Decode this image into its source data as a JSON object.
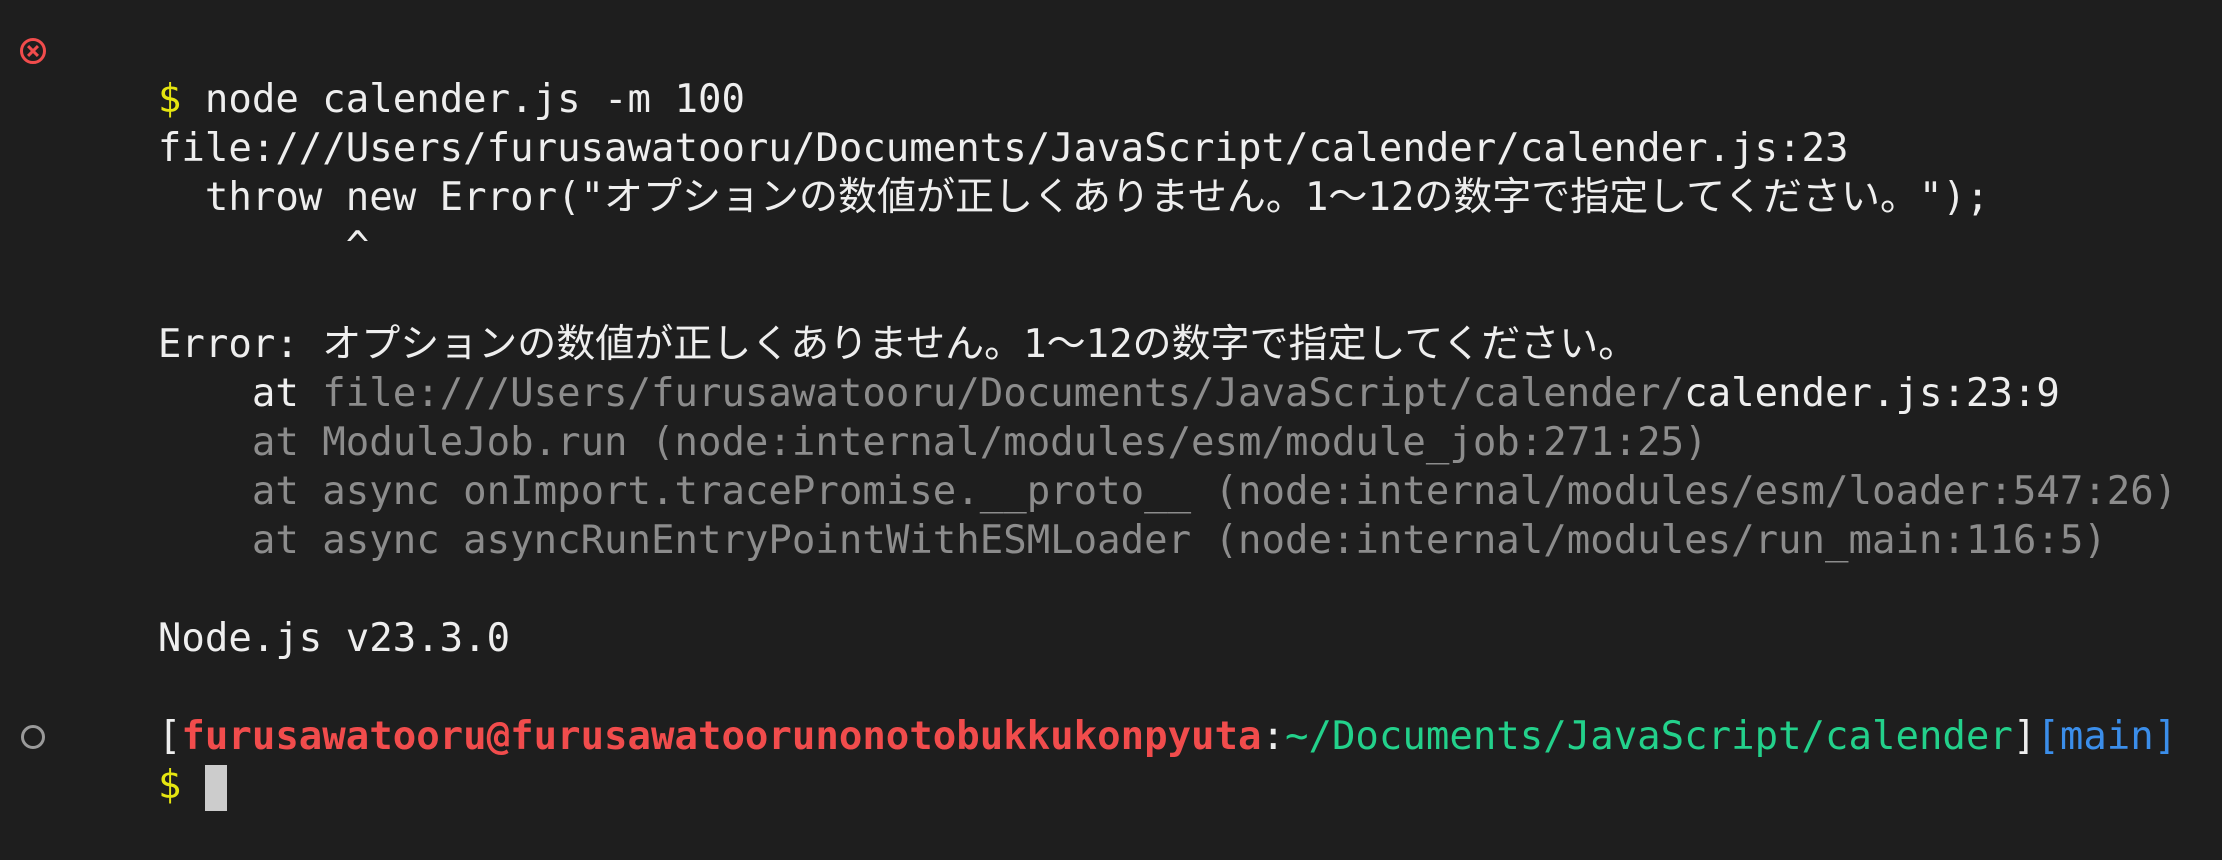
{
  "terminal": {
    "command": {
      "prompt_symbol": "$",
      "text": "node calender.js -m 100"
    },
    "output": {
      "file_ref": "file:///Users/furusawatooru/Documents/JavaScript/calender/calender.js:23",
      "code_line": "  throw new Error(\"オプションの数値が正しくありません。1〜12の数字で指定してください。\");",
      "caret": "        ^",
      "error_message": "Error: オプションの数値が正しくありません。1〜12の数字で指定してください。",
      "stack": [
        {
          "at": "    at ",
          "location_dim": "file:///Users/furusawatooru/Documents/JavaScript/calender/",
          "location_bright": "calender.js:23:9"
        },
        {
          "at": "    at ",
          "location_dim": "ModuleJob.run (node:internal/modules/esm/module_job:271:25)",
          "location_bright": ""
        },
        {
          "at": "    at ",
          "location_dim": "async onImport.tracePromise.__proto__ (node:internal/modules/esm/loader:547:26)",
          "location_bright": ""
        },
        {
          "at": "    at ",
          "location_dim": "async asyncRunEntryPointWithESMLoader (node:internal/modules/run_main:116:5)",
          "location_bright": ""
        }
      ],
      "node_version": "Node.js v23.3.0"
    },
    "prompt": {
      "open_bracket": "[",
      "user_host": "furusawatooru@furusawatoorunonotobukkukonpyuta",
      "colon": ":",
      "cwd": "~/Documents/JavaScript/calender",
      "close_bracket": "]",
      "branch": "[main]",
      "symbol": "$"
    },
    "colors": {
      "background": "#1e1e1e",
      "error": "#f14c4c",
      "prompt_symbol": "#e5e510",
      "path": "#23d18b",
      "branch": "#3b8eea",
      "dim": "#8c8c8c"
    },
    "icons": {
      "failed_command": "error-circle-icon",
      "current_command": "idle-circle-icon"
    }
  }
}
